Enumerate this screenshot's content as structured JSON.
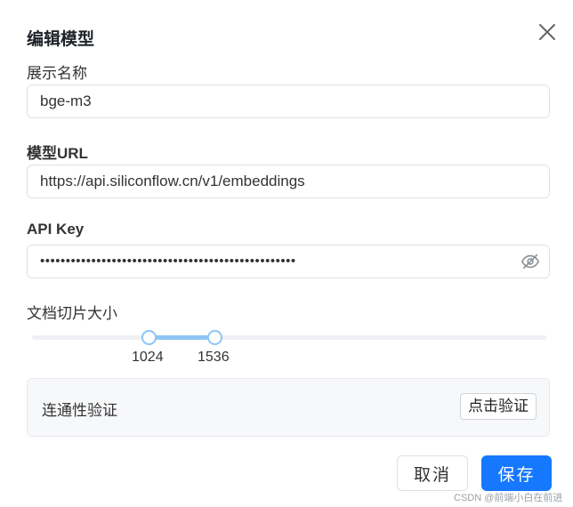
{
  "dialog": {
    "title": "编辑模型"
  },
  "form": {
    "display_name": {
      "label": "展示名称",
      "value": "bge-m3"
    },
    "model_url": {
      "label": "模型URL",
      "value": "https://api.siliconflow.cn/v1/embeddings"
    },
    "api_key": {
      "label": "API Key",
      "value": "••••••••••••••••••••••••••••••••••••••••••••••••••"
    },
    "chunk_size": {
      "label": "文档切片大小",
      "min_value": "1024",
      "max_value": "1536"
    }
  },
  "verify": {
    "label": "连通性验证",
    "button_label": "点击验证"
  },
  "footer": {
    "cancel_label": "取消",
    "save_label": "保存"
  },
  "watermark": "CSDN @前端小白在前进",
  "colors": {
    "primary": "#1677ff",
    "slider": "#8ec5f5",
    "border": "#dcdfe6"
  }
}
